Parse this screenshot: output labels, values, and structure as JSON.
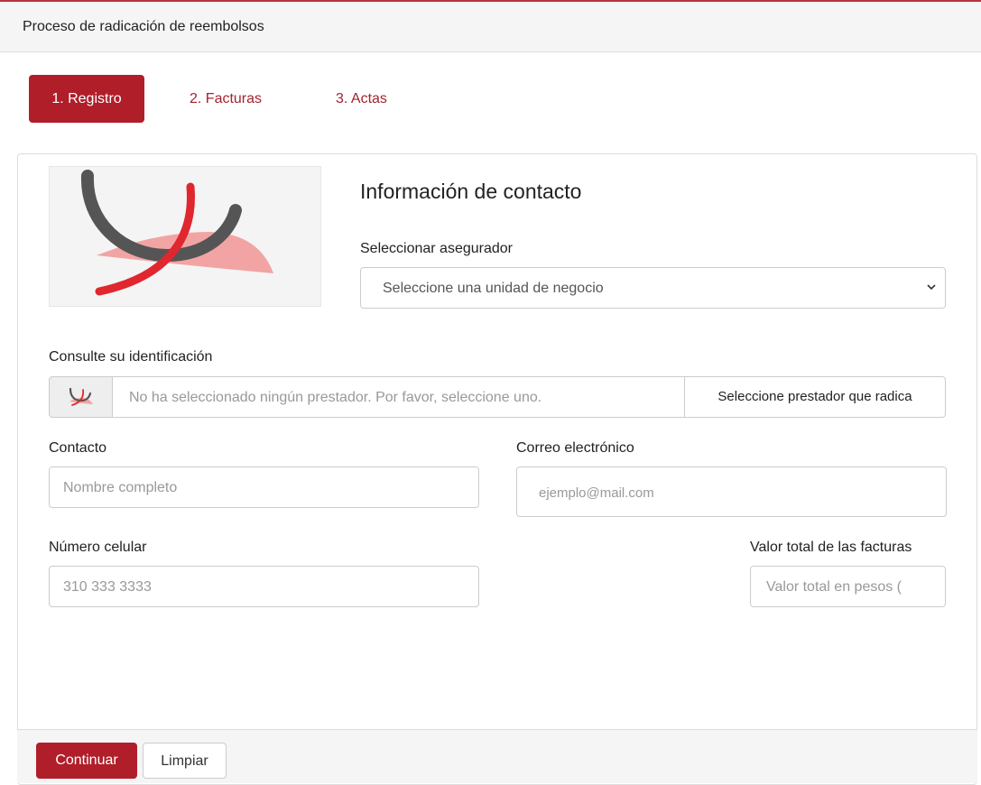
{
  "header": {
    "title": "Proceso de radicación de reembolsos"
  },
  "steps": [
    {
      "label": "1. Registro",
      "active": true
    },
    {
      "label": "2. Facturas",
      "active": false
    },
    {
      "label": "3. Actas",
      "active": false
    }
  ],
  "form": {
    "section_title": "Información de contacto",
    "insurer": {
      "label": "Seleccionar asegurador",
      "selected_value": "Seleccione una unidad de negocio"
    },
    "identification": {
      "label": "Consulte su identificación",
      "value": "No ha seleccionado ningún prestador. Por favor, seleccione uno.",
      "button_label": "Seleccione prestador que radica"
    },
    "contact": {
      "label": "Contacto",
      "placeholder": "Nombre completo"
    },
    "email": {
      "label": "Correo electrónico",
      "placeholder": "ejemplo@mail.com"
    },
    "phone": {
      "label": "Número celular",
      "placeholder": "310 333 3333"
    },
    "total": {
      "label": "Valor total de las facturas",
      "placeholder": "Valor total en pesos ("
    }
  },
  "actions": {
    "continue_label": "Continuar",
    "clear_label": "Limpiar"
  },
  "icons": {
    "logo": "company-logo",
    "addon": "logo-mini-icon",
    "select_caret": "chevron-down-icon"
  },
  "colors": {
    "accent": "#b01e2a",
    "link": "#a32430",
    "logo_gray": "#555555",
    "logo_red": "#e0262e",
    "logo_pink": "#f2a4a4"
  }
}
